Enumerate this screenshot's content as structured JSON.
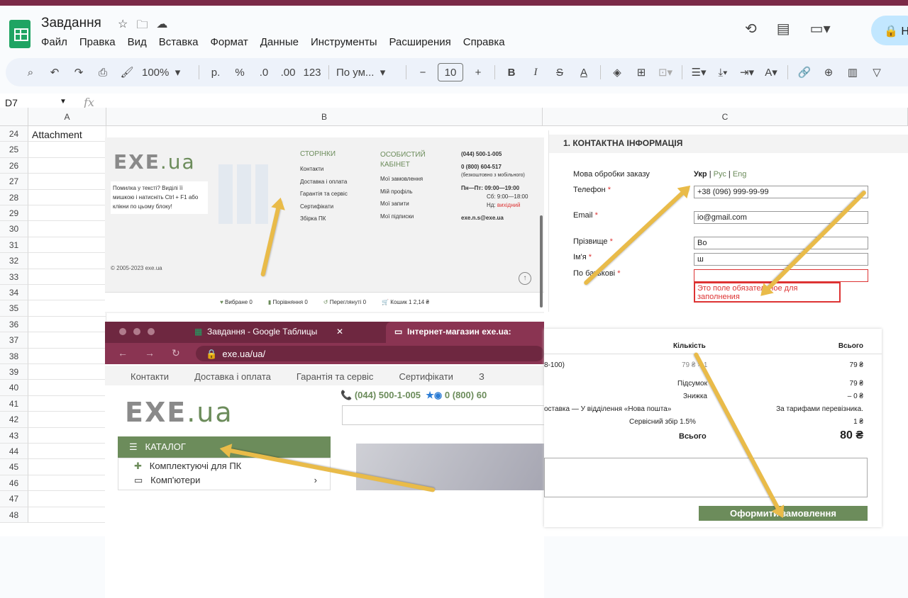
{
  "app": {
    "title": "Завдання",
    "menu": [
      "Файл",
      "Правка",
      "Вид",
      "Вставка",
      "Формат",
      "Данные",
      "Инструменты",
      "Расширения",
      "Справка"
    ],
    "share_label": "Н"
  },
  "toolbar": {
    "zoom": "100%",
    "currency": "р.",
    "percent": "%",
    "dec_less": ".0",
    "dec_more": ".00",
    "number_format": "123",
    "font": "По ум...",
    "font_size": "10"
  },
  "formula_bar": {
    "name_box": "D7",
    "fx": "fx"
  },
  "columns": [
    "A",
    "B",
    "C"
  ],
  "rows": [
    "24",
    "25",
    "26",
    "27",
    "28",
    "29",
    "30",
    "31",
    "32",
    "33",
    "34",
    "35",
    "36",
    "37",
    "38",
    "39",
    "40",
    "41",
    "42",
    "43",
    "44",
    "45",
    "46",
    "47",
    "48"
  ],
  "cell_a24": "Attachment",
  "shot1": {
    "logo_main": "EXE",
    "logo_suffix": ".ua",
    "typo_notice": "Помилка у тексті? Виділі її мишкою і натисніть Ctrl + F1 або клікни по цьому блоку!",
    "pages_title": "СТОРІНКИ",
    "pages": [
      "Контакти",
      "Доставка і оплата",
      "Гарантія та сервіс",
      "Сертифікати",
      "Збірка ПК"
    ],
    "cabinet_title": "ОСОБИСТИЙ КАБІНЕТ",
    "cabinet": [
      "Мої замовлення",
      "Мій профіль",
      "Мої запити",
      "Мої підписки"
    ],
    "phone1": "(044) 500-1-005",
    "phone2": "0 (800) 604-517",
    "phone2_note": "(безкоштовно з мобільного)",
    "hours1": "Пн—Пт: 09:00—19:00",
    "hours2": "Сб: 9:00—18:00",
    "hours3_label": "Нд:",
    "hours3_value": "вихідний",
    "email": "exe.n.s@exe.ua",
    "copyright": "© 2005-2023 exe.ua",
    "bottom_bar": [
      "Вибране 0",
      "Порівняння 0",
      "Переглянуті 0",
      "Кошик 1  2,14 ₴"
    ]
  },
  "shot2": {
    "section_title": "1. КОНТАКТНА ІНФОРМАЦІЯ",
    "lang_label": "Мова обробки заказу",
    "langs": [
      "Укр",
      "Рус",
      "Eng"
    ],
    "phone_label": "Телефон",
    "phone_value": "+38         (096) 999-99-99",
    "email_label": "Email",
    "email_value": "io@gmail.com",
    "surname_label": "Прізвище",
    "surname_value": "Во",
    "name_label": "Ім'я",
    "name_value": "ш",
    "patronymic_label": "По батькові",
    "error": "Это поле обязательное для заполнения"
  },
  "shot3": {
    "tab1": "Завдання - Google Таблицы",
    "tab2": "Інтернет-магазин exe.ua:",
    "url": "exe.ua/ua/",
    "nav": [
      "Контакти",
      "Доставка і оплата",
      "Гарантія та сервіс",
      "Сертифікати",
      "З"
    ],
    "phone": "(044) 500-1-005",
    "phone2": "0 (800) 60",
    "catalog": "КАТАЛОГ",
    "cat1": "Комплектуючі для ПК",
    "cat2": "Комп'ютери"
  },
  "shot4": {
    "col_qty": "Кількість",
    "col_total": "Всього",
    "row_item_left": "8-100)",
    "row_item_qty": "79 ₴ × 1",
    "row_item_total": "79 ₴",
    "subtotal_label": "Підсумок",
    "subtotal_value": "79 ₴",
    "discount_label": "Знижка",
    "discount_value": "– 0 ₴",
    "delivery_label": "оставка — У відділення «Нова пошта»",
    "delivery_value": "За тарифами перевізника.",
    "fee_label": "Сервісний збір 1.5%",
    "fee_value": "1 ₴",
    "total_label": "Всього",
    "total_value": "80 ₴",
    "submit": "Оформити замовлення"
  },
  "colors": {
    "accent_green": "#6c8c5b",
    "arrow": "#e9bb49",
    "sheets_green": "#1fa463"
  }
}
